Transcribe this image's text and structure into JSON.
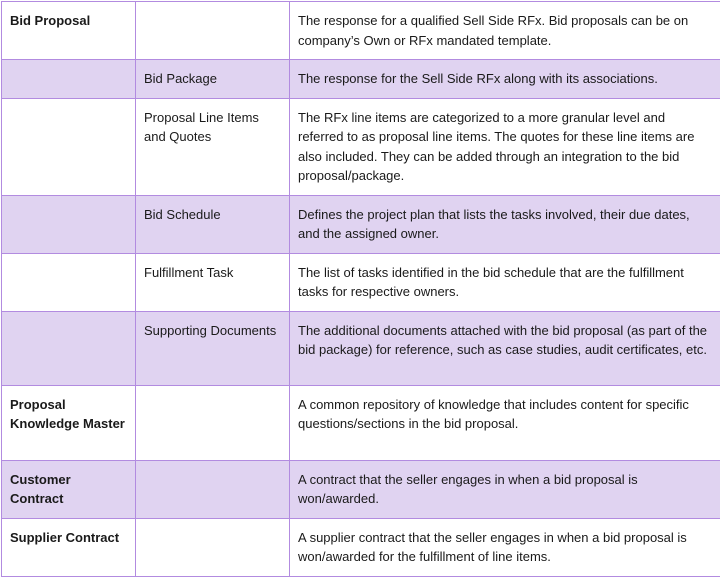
{
  "colors": {
    "border": "#b28be0",
    "shaded_row": "#e0d3f1",
    "text": "#1a1a1a"
  },
  "rows": [
    {
      "entity": "Bid Proposal",
      "sub_entity": "",
      "description": "The response for a qualified Sell Side RFx. Bid proposals can be on company’s Own or RFx mandated template.",
      "shaded": false
    },
    {
      "entity": "",
      "sub_entity": "Bid Package",
      "description": "The response for the Sell Side RFx along with its associations.",
      "shaded": true
    },
    {
      "entity": "",
      "sub_entity": "Proposal Line Items and Quotes",
      "description": "The RFx line items are categorized to a more granular level and referred to as proposal line items. The quotes for these line items are also included. They can be added through an integration to the bid proposal/package.",
      "shaded": false
    },
    {
      "entity": "",
      "sub_entity": "Bid Schedule",
      "description": "Defines the project plan that lists the tasks involved, their due dates, and the assigned owner.",
      "shaded": true
    },
    {
      "entity": "",
      "sub_entity": "Fulfillment Task",
      "description": "The list of tasks identified in the bid schedule that are the fulfillment tasks for respective owners.",
      "shaded": false
    },
    {
      "entity": "",
      "sub_entity": "Supporting Documents",
      "description": "The additional documents attached with the bid proposal (as part of the bid package) for reference, such as case studies, audit certificates, etc.",
      "shaded": true
    },
    {
      "entity": "Proposal Knowledge Master",
      "sub_entity": "",
      "description": "A common repository of knowledge that includes content for specific questions/sections in the bid proposal.",
      "shaded": false
    },
    {
      "entity": "Customer Contract",
      "sub_entity": "",
      "description": "A contract that the seller engages in when a bid proposal is won/awarded.",
      "shaded": true
    },
    {
      "entity": "Supplier Contract",
      "sub_entity": "",
      "description": "A supplier contract that the seller engages in when a bid proposal is won/awarded for the fulfillment of line items.",
      "shaded": false
    }
  ]
}
